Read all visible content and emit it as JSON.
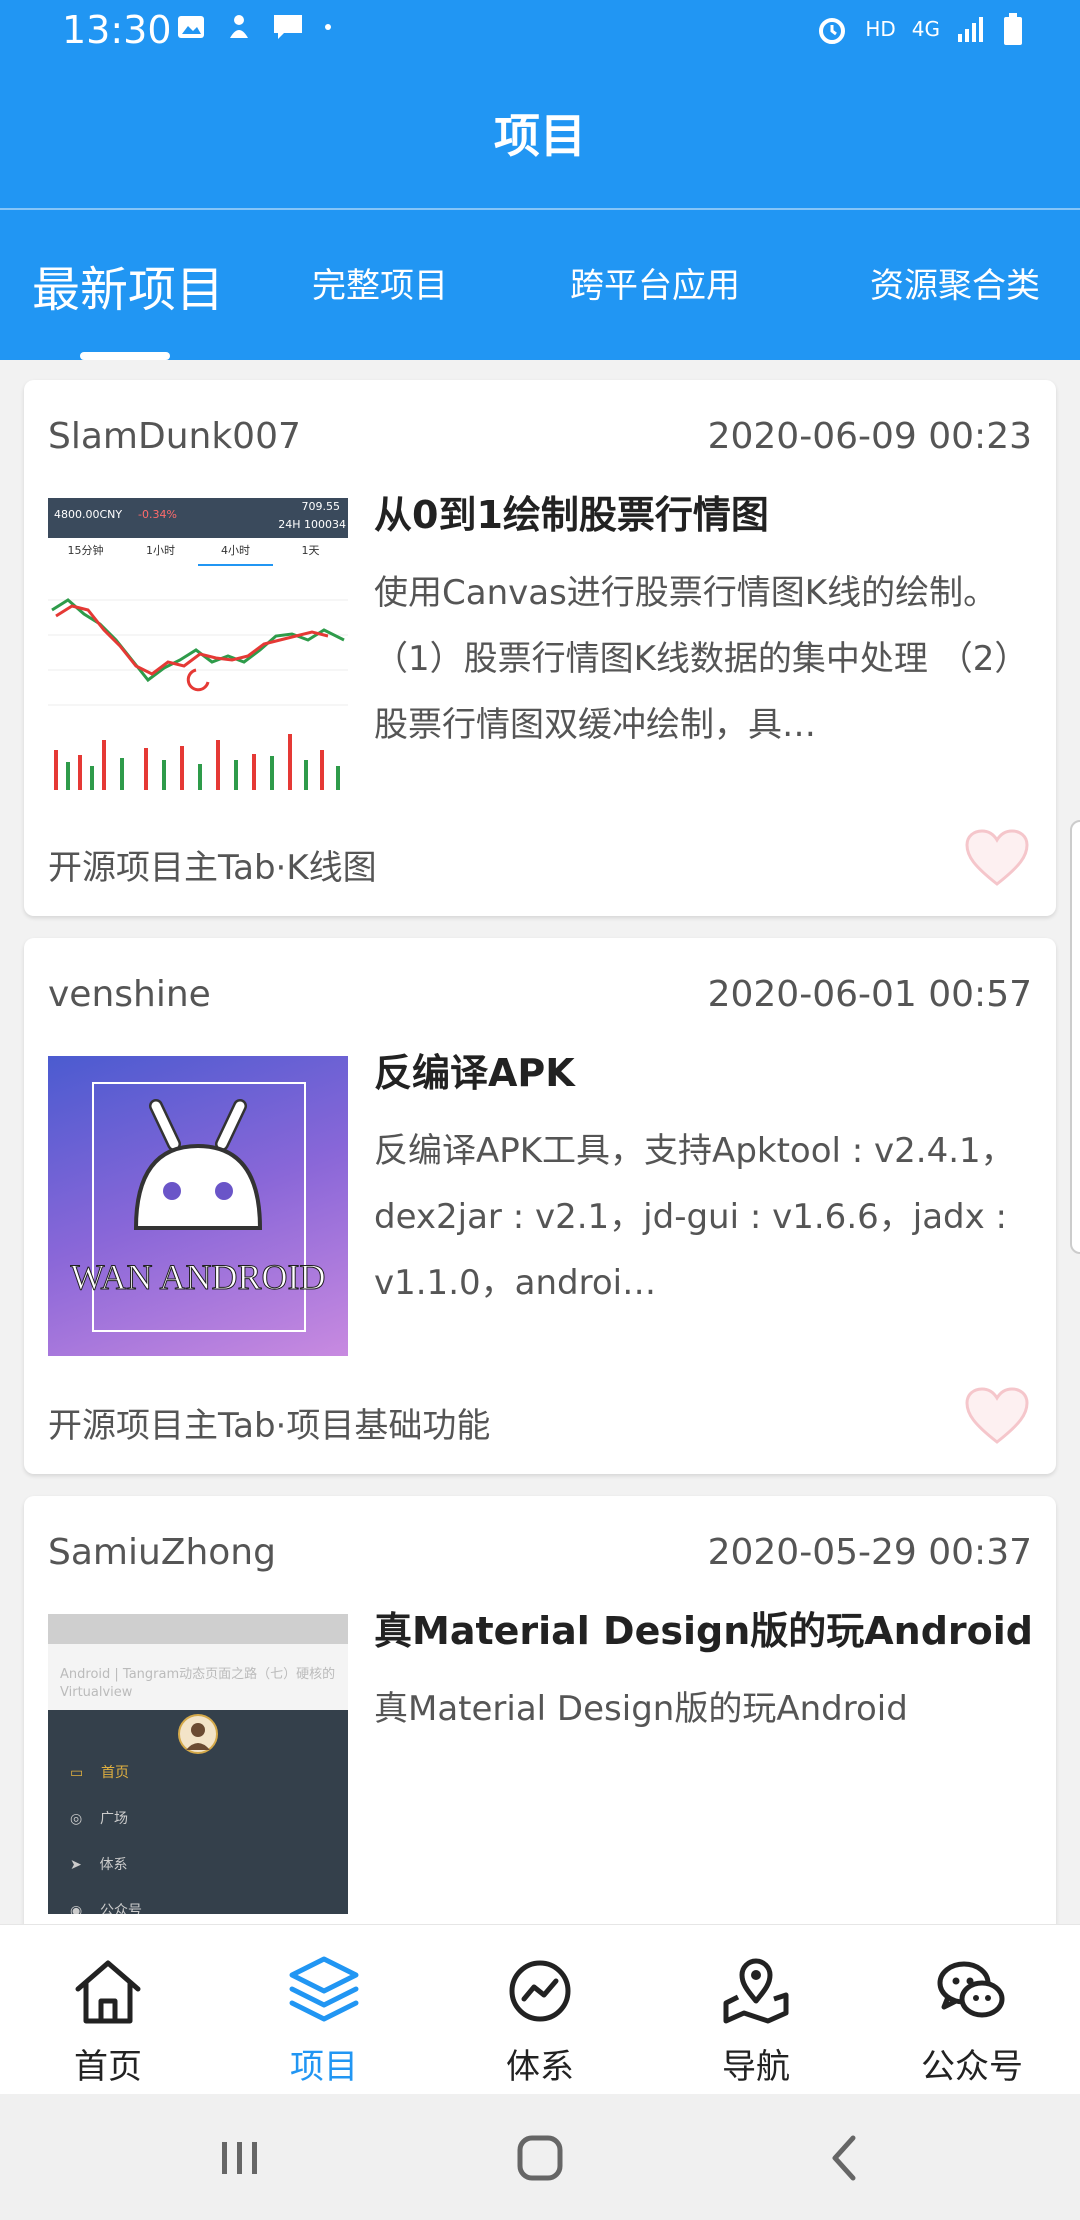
{
  "status_bar": {
    "time": "13:30",
    "network": "HD",
    "signal": "4G"
  },
  "header": {
    "title": "项目"
  },
  "tabs": [
    {
      "label": "最新项目"
    },
    {
      "label": "完整项目"
    },
    {
      "label": "跨平台应用"
    },
    {
      "label": "资源聚合类"
    }
  ],
  "projects": [
    {
      "author": "SlamDunk007",
      "date": "2020-06-09 00:23",
      "title": "从0到1绘制股票行情图",
      "desc": "使用Canvas进行股票行情图K线的绘制。 （1）股票行情图K线数据的集中处理 （2）股票行情图双缓冲绘制，具…",
      "chapter": "开源项目主Tab·K线图",
      "thumb": {
        "price": "4800.00CNY",
        "change": "-0.34%",
        "high": "709.55",
        "vol": "24H  100034",
        "tabs": [
          "15分钟",
          "1小时",
          "4小时",
          "1天"
        ]
      }
    },
    {
      "author": "venshine",
      "date": "2020-06-01 00:57",
      "title": "反编译APK",
      "desc": "反编译APK工具，支持Apktool : v2.4.1，dex2jar : v2.1，jd-gui : v1.6.6，jadx : v1.1.0，androi…",
      "chapter": "开源项目主Tab·项目基础功能",
      "thumb": {
        "label": "WAN ANDROID"
      }
    },
    {
      "author": "SamiuZhong",
      "date": "2020-05-29 00:37",
      "title": "真Material Design版的玩Android",
      "desc": "真Material Design版的玩Android",
      "chapter": "",
      "thumb": {
        "header_text": "Android | Tangram动态页面之路（七）硬核的Virtualview",
        "menu": [
          "首页",
          "广场",
          "体系",
          "公众号"
        ]
      }
    }
  ],
  "bottom_nav": [
    {
      "label": "首页",
      "icon": "home-icon"
    },
    {
      "label": "项目",
      "icon": "layers-icon"
    },
    {
      "label": "体系",
      "icon": "trend-icon"
    },
    {
      "label": "导航",
      "icon": "map-pin-icon"
    },
    {
      "label": "公众号",
      "icon": "wechat-icon"
    }
  ],
  "colors": {
    "primary": "#2196f3",
    "heart": "#f5c6cb"
  }
}
